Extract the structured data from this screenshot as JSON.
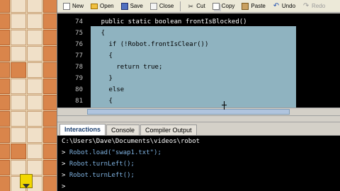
{
  "toolbar": {
    "items": [
      {
        "label": "New",
        "icon": "new-file-icon",
        "enabled": true
      },
      {
        "label": "Open",
        "icon": "open-folder-icon",
        "enabled": true
      },
      {
        "label": "Save",
        "icon": "save-disk-icon",
        "enabled": true
      },
      {
        "label": "Close",
        "icon": "close-file-icon",
        "enabled": true
      },
      {
        "label": "Cut",
        "icon": "scissors-icon",
        "enabled": true
      },
      {
        "label": "Copy",
        "icon": "copy-icon",
        "enabled": true
      },
      {
        "label": "Paste",
        "icon": "paste-icon",
        "enabled": true
      },
      {
        "label": "Undo",
        "icon": "undo-icon",
        "enabled": true
      },
      {
        "label": "Redo",
        "icon": "redo-icon",
        "enabled": false
      }
    ]
  },
  "editor": {
    "lines": [
      {
        "num": "74",
        "text": "    public static boolean frontIsBlocked()"
      },
      {
        "num": "75",
        "text": "    {"
      },
      {
        "num": "76",
        "text": "      if (!Robot.frontIsClear())"
      },
      {
        "num": "77",
        "text": "      {"
      },
      {
        "num": "78",
        "text": "        return true;"
      },
      {
        "num": "79",
        "text": "      }"
      },
      {
        "num": "80",
        "text": "      else"
      },
      {
        "num": "81",
        "text": "      {"
      }
    ]
  },
  "tabs": [
    {
      "label": "Interactions",
      "active": true
    },
    {
      "label": "Console",
      "active": false
    },
    {
      "label": "Compiler Output",
      "active": false
    }
  ],
  "console": {
    "path": "C:\\Users\\Dave\\Documents\\videos\\robot",
    "lines": [
      {
        "prompt": "> ",
        "text": "Robot.load(\"swap1.txt\");"
      },
      {
        "prompt": "> ",
        "text": "Robot.turnLeft();"
      },
      {
        "prompt": "> ",
        "text": "Robot.turnLeft();"
      },
      {
        "prompt": "> ",
        "text": ""
      }
    ]
  },
  "colors": {
    "editor_bg": "#000000",
    "selection": "#8fb3c0",
    "wall": "#d9854b",
    "robot": "#f2d700"
  }
}
